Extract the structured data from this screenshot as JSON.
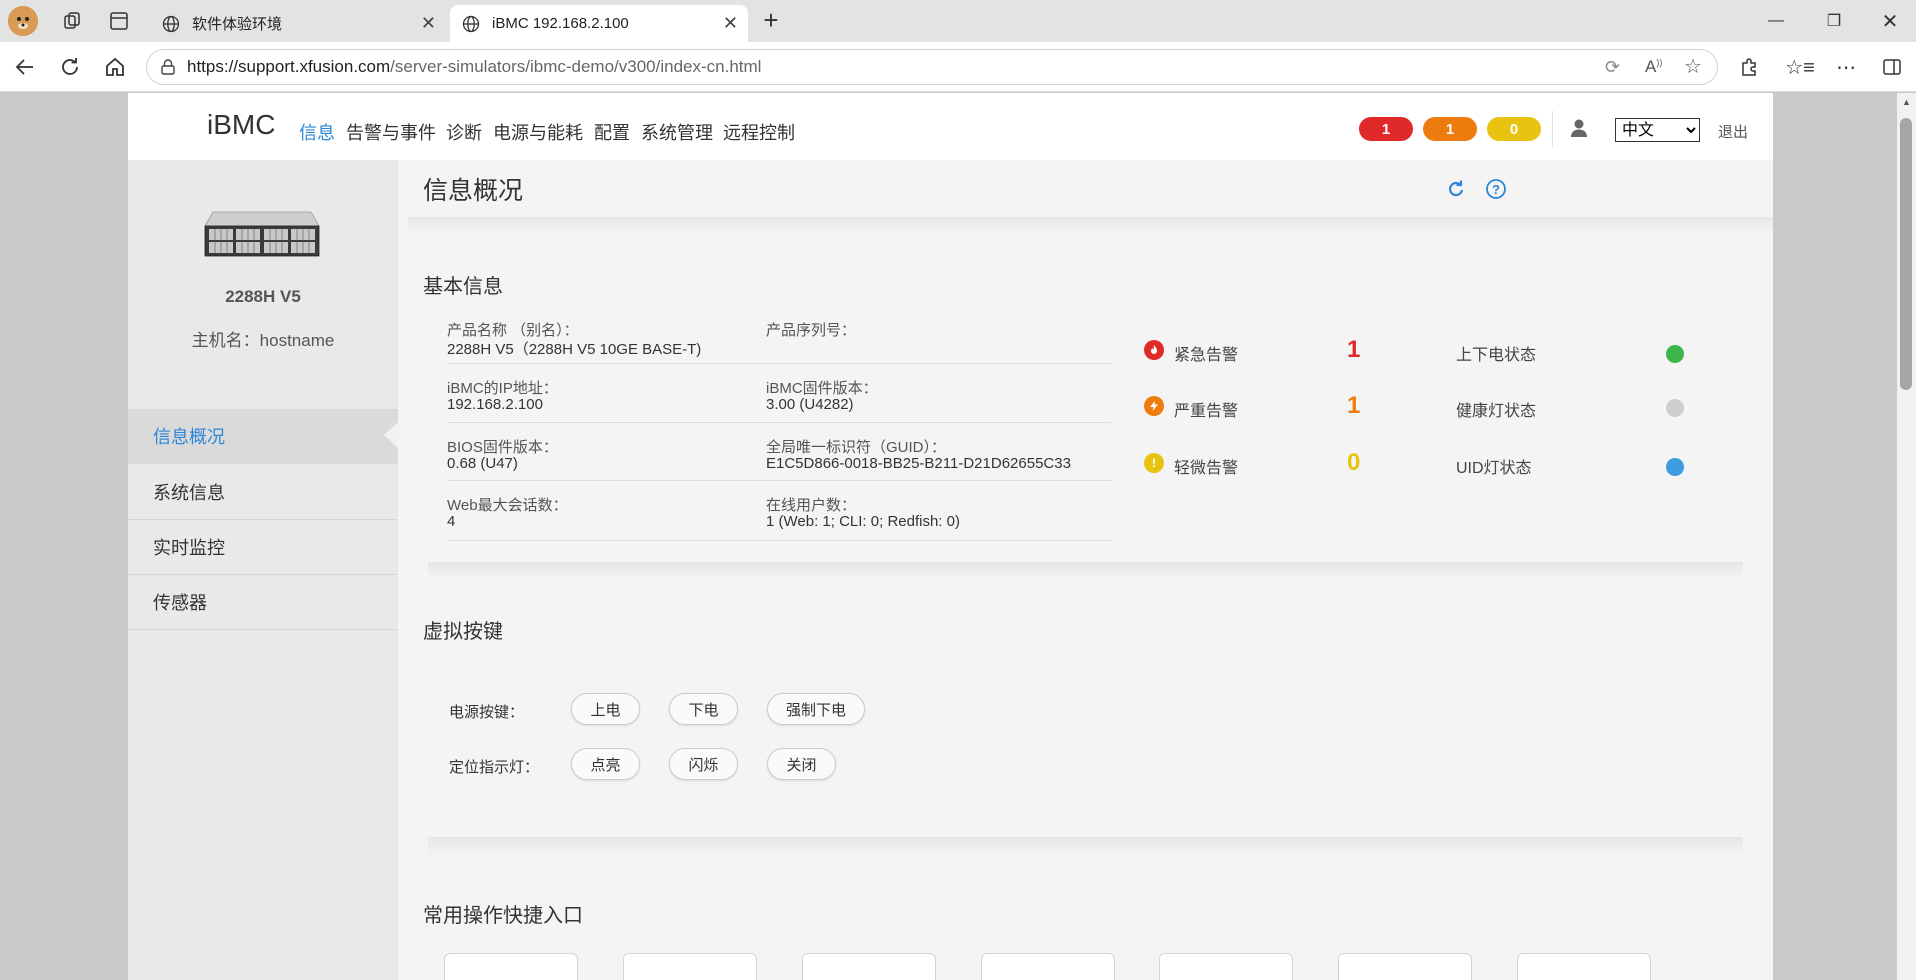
{
  "browser": {
    "tabs": [
      {
        "title": "软件体验环境",
        "active": false
      },
      {
        "title": "iBMC 192.168.2.100",
        "active": true
      }
    ],
    "url_host": "https://support.xfusion.com",
    "url_path": "/server-simulators/ibmc-demo/v300/index-cn.html"
  },
  "app": {
    "logo": "iBMC",
    "menu": [
      "信息",
      "告警与事件",
      "诊断",
      "电源与能耗",
      "配置",
      "系统管理",
      "远程控制"
    ],
    "alarm_pills": [
      {
        "count": "1",
        "color": "#e02a2a"
      },
      {
        "count": "1",
        "color": "#ee7b0e"
      },
      {
        "count": "0",
        "color": "#e8c310"
      }
    ],
    "language": "中文",
    "logout": "退出"
  },
  "sidebar": {
    "model": "2288H V5",
    "hostname": "主机名：hostname",
    "items": [
      {
        "label": "信息概况",
        "active": true
      },
      {
        "label": "系统信息",
        "active": false
      },
      {
        "label": "实时监控",
        "active": false
      },
      {
        "label": "传感器",
        "active": false
      }
    ]
  },
  "main": {
    "title": "信息概况",
    "basic_info": {
      "title": "基本信息",
      "rows": [
        [
          {
            "label": "产品名称 （别名）：",
            "value": "2288H V5（2288H V5 10GE BASE-T)"
          },
          {
            "label": "产品序列号：",
            "value": ""
          }
        ],
        [
          {
            "label": "iBMC的IP地址：",
            "value": "192.168.2.100"
          },
          {
            "label": "iBMC固件版本：",
            "value": "3.00 (U4282)"
          }
        ],
        [
          {
            "label": "BIOS固件版本：",
            "value": "0.68 (U47)"
          },
          {
            "label": "全局唯一标识符（GUID）：",
            "value": "E1C5D866-0018-BB25-B211-D21D62655C33"
          }
        ],
        [
          {
            "label": "Web最大会话数：",
            "value": "4"
          },
          {
            "label": "在线用户数：",
            "value": "1 (Web: 1; CLI: 0; Redfish: 0)"
          }
        ]
      ],
      "alarms": [
        {
          "label": "紧急告警",
          "count": "1",
          "color": "#e02a2a",
          "icon": "flame-icon"
        },
        {
          "label": "严重告警",
          "count": "1",
          "color": "#ee7b0e",
          "icon": "bolt-icon"
        },
        {
          "label": "轻微告警",
          "count": "0",
          "color": "#e8c310",
          "icon": "exclamation-icon"
        }
      ],
      "status": [
        {
          "label": "上下电状态",
          "color": "#3cb64a"
        },
        {
          "label": "健康灯状态",
          "color": "#cfcfcf"
        },
        {
          "label": "UID灯状态",
          "color": "#3d9be0"
        }
      ]
    },
    "virtual_buttons": {
      "title": "虚拟按键",
      "power_label": "电源按键：",
      "power_buttons": [
        "上电",
        "下电",
        "强制下电"
      ],
      "locator_label": "定位指示灯：",
      "locator_buttons": [
        "点亮",
        "闪烁",
        "关闭"
      ]
    },
    "quick_access": {
      "title": "常用操作快捷入口"
    }
  }
}
